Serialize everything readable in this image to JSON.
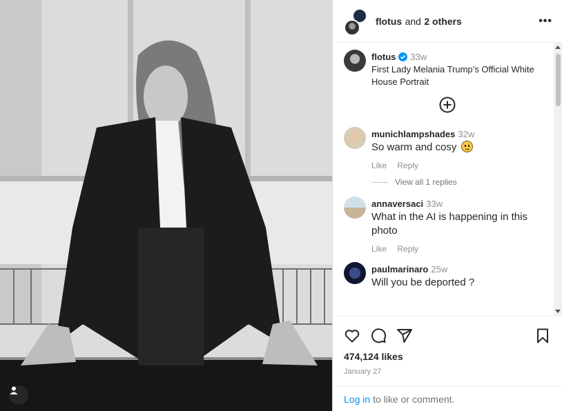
{
  "post": {
    "header": {
      "username": "flotus",
      "conjunction": "and",
      "others": "2 others",
      "more_icon": "more-horizontal-icon"
    },
    "caption": {
      "username": "flotus",
      "verified": true,
      "time": "33w",
      "text": "First Lady Melania Trump’s Official White House Portrait"
    },
    "load_more_icon": "plus-circle-icon",
    "comments": [
      {
        "username": "munichlampshades",
        "time": "32w",
        "text": "So warm and cosy",
        "emoji": "grimace-face",
        "like_label": "Like",
        "reply_label": "Reply",
        "view_replies": "View all 1 replies"
      },
      {
        "username": "annaversaci",
        "time": "33w",
        "text": "What in the AI is happening in this photo",
        "like_label": "Like",
        "reply_label": "Reply"
      },
      {
        "username": "paulmarinaro",
        "time": "25w",
        "text": "Will you be deported ?"
      }
    ],
    "actions": {
      "like_icon": "heart-icon",
      "comment_icon": "comment-icon",
      "share_icon": "send-icon",
      "save_icon": "bookmark-icon"
    },
    "likes": "474,124 likes",
    "date": "January 27",
    "login": {
      "link": "Log in",
      "rest": "to like or comment."
    }
  },
  "colors": {
    "link": "#0095f6",
    "verified": "#0095f6",
    "muted": "#8e8e8e"
  }
}
